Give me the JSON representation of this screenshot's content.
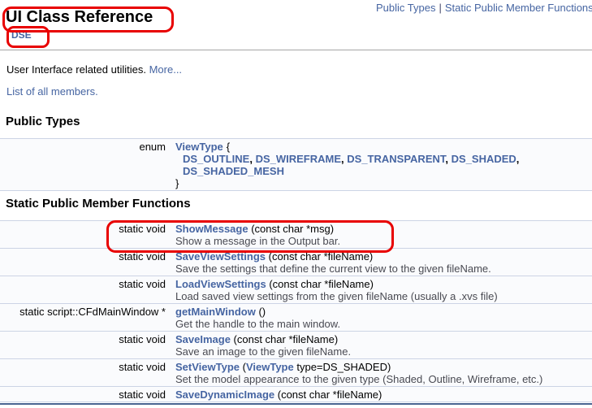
{
  "page": {
    "header_links": [
      "Public Types",
      "Static Public Member Functions"
    ],
    "header_separator": "|",
    "title": "UI Class Reference",
    "class_link": "DSE",
    "intro_text": "User Interface related utilities.",
    "more_link": "More...",
    "list_members_link": "List of all members."
  },
  "public_types": {
    "heading": "Public Types",
    "enum_keyword": "enum",
    "enum_name": "ViewType",
    "open_brace": "{",
    "close_brace": "}",
    "separator": ",",
    "values_line1": [
      "DS_OUTLINE",
      "DS_WIREFRAME",
      "DS_TRANSPARENT",
      "DS_SHADED"
    ],
    "values_line2": [
      "DS_SHADED_MESH"
    ]
  },
  "member_functions": {
    "heading": "Static Public Member Functions",
    "rows": [
      {
        "left": "static void",
        "name": "ShowMessage",
        "params": " (const char *msg)",
        "desc": "Show a message in the Output bar."
      },
      {
        "left": "static void",
        "name": "SaveViewSettings",
        "params": " (const char *fileName)",
        "desc": "Save the settings that define the current view to the given fileName."
      },
      {
        "left": "static void",
        "name": "LoadViewSettings",
        "params": " (const char *fileName)",
        "desc": "Load saved view settings from the given fileName (usually a .xvs file)"
      },
      {
        "left": "static script::CFdMainWindow *",
        "name": "getMainWindow",
        "params": " ()",
        "desc": "Get the handle to the main window."
      },
      {
        "left": "static void",
        "name": "SaveImage",
        "params": " (const char *fileName)",
        "desc": "Save an image to the given fileName."
      },
      {
        "left": "static void",
        "name": "SetViewType",
        "params_prefix": " (",
        "params_link": "ViewType",
        "params_suffix": " type=DS_SHADED)",
        "desc": "Set the model appearance to the given type (Shaded, Outline, Wireframe, etc.)"
      },
      {
        "left": "static void",
        "name": "SaveDynamicImage",
        "params": " (const char *fileName)",
        "desc": ""
      }
    ]
  },
  "annotations": {
    "color": "#e80000",
    "items": [
      "title-circle",
      "class-link-circle",
      "showmessage-row-circle"
    ]
  },
  "colors": {
    "link": "#4665a2",
    "row_background": "#fafbfd",
    "row_separator": "#ccd4e5",
    "bottom_line": "#4a6592"
  }
}
